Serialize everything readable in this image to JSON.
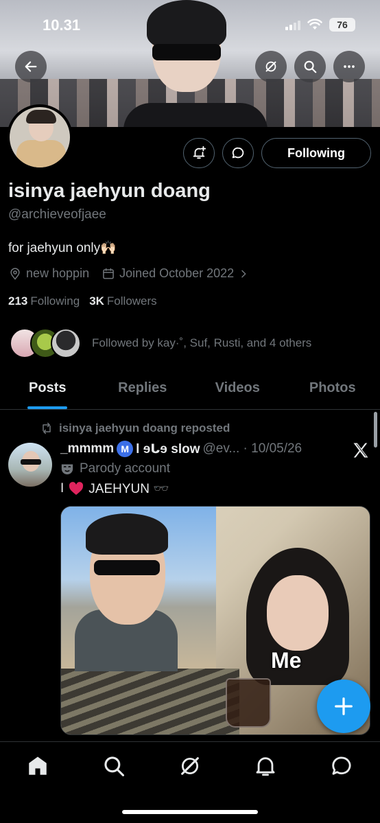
{
  "status_bar": {
    "time": "10.31",
    "battery": "76"
  },
  "profile": {
    "display_name": "isinya jaehyun doang",
    "handle": "@archieveofjaee",
    "bio": "for jaehyun only🙌🏻",
    "location": "new hoppin",
    "joined": "Joined October 2022",
    "following_count": "213",
    "following_label": "Following",
    "followers_count": "3K",
    "followers_label": "Followers",
    "followed_by": "Followed by kay·˚, Suf, Rusti, and 4 others",
    "follow_button_label": "Following"
  },
  "tabs": [
    {
      "label": "Posts",
      "active": true
    },
    {
      "label": "Replies",
      "active": false
    },
    {
      "label": "Videos",
      "active": false
    },
    {
      "label": "Photos",
      "active": false
    }
  ],
  "post": {
    "repost_label": "isinya jaehyun doang reposted",
    "author_name": "_mmmm",
    "author_badge": "M",
    "author_suffix": "l ɘᒐɘ slow",
    "author_handle_date": "@ev... · 10/05/26",
    "parody_label": "Parody account",
    "text_prefix": "I",
    "text_suffix": "JAEHYUN 🕶️",
    "media_caption": "Me"
  },
  "icons": {
    "back": "back-arrow-icon",
    "grok": "grok-icon",
    "search": "search-icon",
    "more": "more-icon",
    "notify": "bell-plus-icon",
    "message": "message-icon",
    "location": "location-pin-icon",
    "calendar": "calendar-icon",
    "retweet": "repost-icon",
    "parody": "mask-icon",
    "x_logo": "x-logo-icon",
    "compose": "plus-icon",
    "nav": [
      "home-icon",
      "search-icon",
      "grok-icon",
      "bell-icon",
      "message-icon"
    ]
  },
  "colors": {
    "accent": "#1d9bf0",
    "text": "#e7e9ea",
    "muted": "#71767b",
    "border": "#2f3336",
    "background": "#000000"
  }
}
